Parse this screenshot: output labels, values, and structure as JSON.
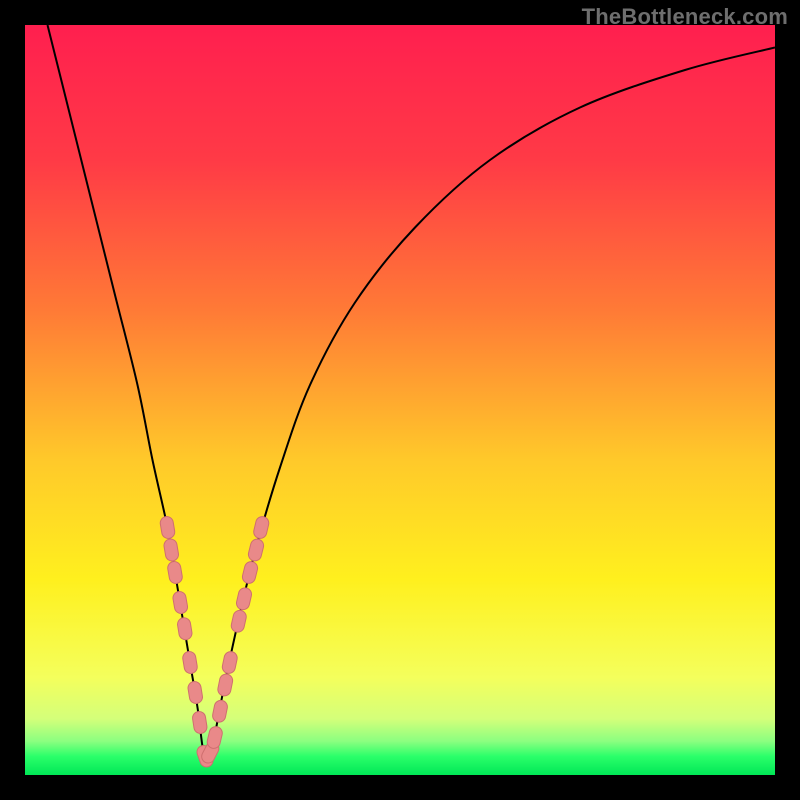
{
  "watermark": "TheBottleneck.com",
  "colors": {
    "frame": "#000000",
    "curve": "#000000",
    "marker_fill": "#e98989",
    "marker_stroke": "#cf6f6f",
    "green_band": "#00e756",
    "gradient_stops": [
      {
        "offset": 0.0,
        "color": "#ff1f4f"
      },
      {
        "offset": 0.18,
        "color": "#ff3a46"
      },
      {
        "offset": 0.38,
        "color": "#ff7a36"
      },
      {
        "offset": 0.58,
        "color": "#ffc92a"
      },
      {
        "offset": 0.74,
        "color": "#fff01e"
      },
      {
        "offset": 0.87,
        "color": "#f4ff5c"
      },
      {
        "offset": 0.925,
        "color": "#d4ff7a"
      },
      {
        "offset": 0.955,
        "color": "#8bff80"
      },
      {
        "offset": 0.975,
        "color": "#2bff6a"
      },
      {
        "offset": 1.0,
        "color": "#00e756"
      }
    ]
  },
  "chart_data": {
    "type": "line",
    "title": "",
    "xlabel": "",
    "ylabel": "",
    "xlim": [
      0,
      100
    ],
    "ylim": [
      0,
      100
    ],
    "x_of_minimum": 24,
    "series": [
      {
        "name": "bottleneck-curve",
        "x": [
          3,
          6,
          9,
          12,
          15,
          17,
          19,
          20,
          21,
          22,
          23,
          24,
          25,
          26,
          27,
          29,
          31,
          34,
          38,
          44,
          52,
          62,
          74,
          88,
          100
        ],
        "y": [
          100,
          88,
          76,
          64,
          52,
          42,
          33,
          27,
          21,
          15,
          9,
          2,
          4,
          9,
          14,
          23,
          31,
          41,
          52,
          63,
          73,
          82,
          89,
          94,
          97
        ]
      }
    ],
    "markers": {
      "name": "highlighted-points",
      "x": [
        19.0,
        19.5,
        20.0,
        20.7,
        21.3,
        22.0,
        22.7,
        23.3,
        24.0,
        24.7,
        25.3,
        26.0,
        26.7,
        27.3,
        28.5,
        29.2,
        30.0,
        30.8,
        31.5
      ],
      "y": [
        33,
        30,
        27,
        23,
        19.5,
        15,
        11,
        7,
        2.5,
        3,
        5,
        8.5,
        12,
        15,
        20.5,
        23.5,
        27,
        30,
        33
      ]
    }
  }
}
